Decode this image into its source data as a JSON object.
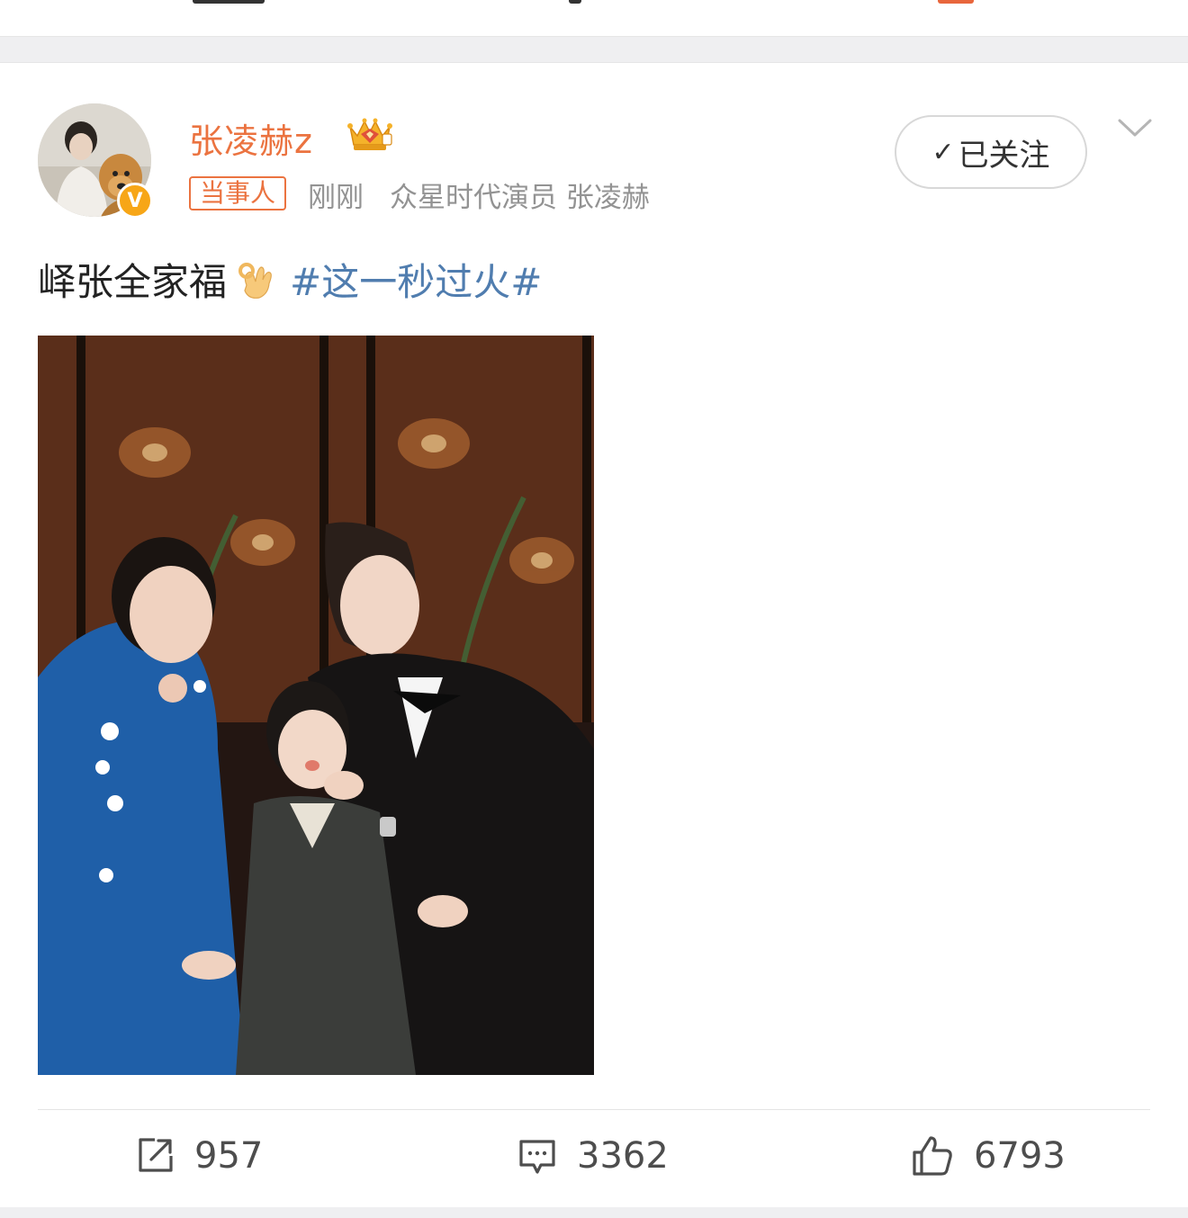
{
  "post": {
    "author": {
      "name": "张凌赫z",
      "verified_badge": "V",
      "avatar_icon": "avatar-with-dog",
      "crown_icon": "vip-crown-icon"
    },
    "tag": "当事人",
    "time": "刚刚",
    "source": "众星时代演员 张凌赫",
    "follow_button": {
      "check": "✓",
      "label": "已关注"
    },
    "text": "峄张全家福",
    "emoji": "ok-hand",
    "topic": "#这一秒过火#",
    "image": "family-portrait"
  },
  "actions": {
    "repost": "957",
    "comment": "3362",
    "like": "6793"
  },
  "colors": {
    "username": "#eb7340",
    "topic": "#507daf",
    "meta": "#939393",
    "badge": "#f7a617"
  }
}
